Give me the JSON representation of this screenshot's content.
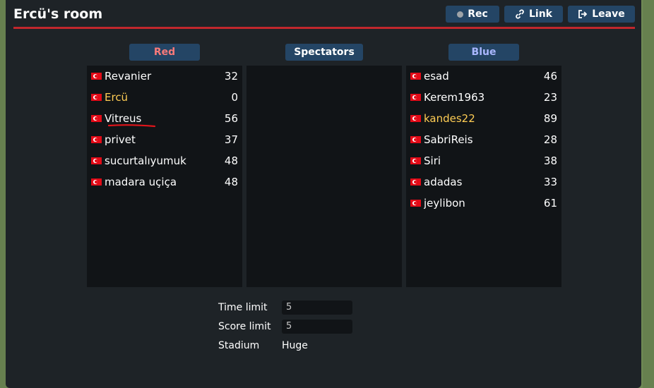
{
  "room": {
    "title": "Ercü's room",
    "buttons": {
      "rec": "Rec",
      "link": "Link",
      "leave": "Leave"
    }
  },
  "teams": {
    "red": {
      "label": "Red",
      "players": [
        {
          "name": "Revanier",
          "score": "32",
          "admin": false
        },
        {
          "name": "Ercü",
          "score": "0",
          "admin": true
        },
        {
          "name": "Vitreus",
          "score": "56",
          "admin": false
        },
        {
          "name": "privet",
          "score": "37",
          "admin": false
        },
        {
          "name": "sucurtalıyumuk",
          "score": "48",
          "admin": false
        },
        {
          "name": "madara uçiça",
          "score": "48",
          "admin": false
        }
      ]
    },
    "spectators": {
      "label": "Spectators",
      "players": []
    },
    "blue": {
      "label": "Blue",
      "players": [
        {
          "name": "esad",
          "score": "46",
          "admin": false
        },
        {
          "name": "Kerem1963",
          "score": "23",
          "admin": false
        },
        {
          "name": "kandes22",
          "score": "89",
          "admin": true
        },
        {
          "name": "SabriReis",
          "score": "28",
          "admin": false
        },
        {
          "name": "Siri",
          "score": "38",
          "admin": false
        },
        {
          "name": "adadas",
          "score": "33",
          "admin": false
        },
        {
          "name": "jeylibon",
          "score": "61",
          "admin": false
        }
      ]
    }
  },
  "settings": {
    "time_limit_label": "Time limit",
    "time_limit_value": "5",
    "score_limit_label": "Score limit",
    "score_limit_value": "5",
    "stadium_label": "Stadium",
    "stadium_value": "Huge"
  },
  "colors": {
    "accent_line": "#c1272d",
    "button": "#244565",
    "admin_name": "#ffcd54",
    "red_label": "#fa7a7a",
    "blue_label": "#a9b7ff"
  },
  "icons": {
    "flag": "turkey-flag-icon",
    "rec": "record-dot-icon",
    "link": "link-icon",
    "leave": "leave-icon"
  }
}
